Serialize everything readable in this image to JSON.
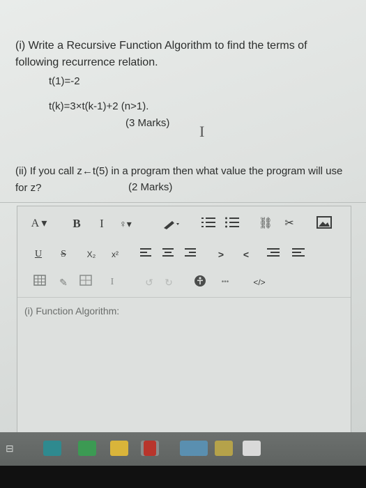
{
  "question": {
    "title": "(i) Write a Recursive Function Algorithm to find the terms of following recurrence relation.",
    "base_case": "t(1)=-2",
    "recurrence": "t(k)=3×t(k-1)+2   (n>1).",
    "marks_1": "(3 Marks)",
    "part2": "(ii) If you call z←t(5) in a program then what value the program will use for z?",
    "marks_2": "(2 Marks)"
  },
  "toolbar": {
    "font_label": "A",
    "bold": "B",
    "italic": "I",
    "underline": "U",
    "strike": "S",
    "subscript": "X₂",
    "superscript": "x²",
    "code": "</>"
  },
  "editor": {
    "content": "(i) Function Algorithm:"
  },
  "taskbar": {
    "colors": [
      "#2f8a8f",
      "#3c9a53",
      "#d9b43a",
      "#8a8d8c",
      "#b8352c",
      "#5a8fb0",
      "#b5a24a",
      "#d9d9d9"
    ]
  }
}
